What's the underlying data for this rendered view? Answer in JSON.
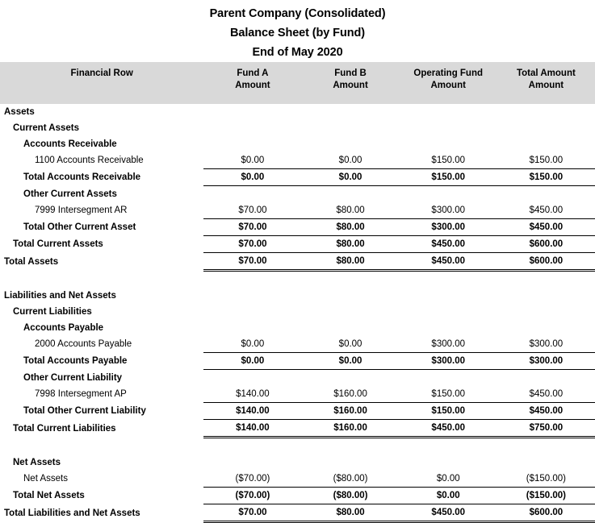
{
  "title": {
    "line1": "Parent Company (Consolidated)",
    "line2": "Balance Sheet (by Fund)",
    "line3": "End of May 2020"
  },
  "header": {
    "label_col": "Financial Row",
    "columns": [
      {
        "name": "Fund A",
        "sub": "Amount"
      },
      {
        "name": "Fund B",
        "sub": "Amount"
      },
      {
        "name": "Operating Fund",
        "sub": "Amount"
      },
      {
        "name": "Total Amount",
        "sub": "Amount"
      }
    ]
  },
  "colors": {
    "header_band": "#D9D9D9",
    "text": "#000000",
    "rule": "#000000",
    "page": "#FFFFFF"
  },
  "rows": [
    {
      "label": "Assets",
      "level": 0,
      "bold": true,
      "values": [
        "",
        "",
        "",
        ""
      ],
      "rule": "none"
    },
    {
      "label": "Current Assets",
      "level": 1,
      "bold": true,
      "values": [
        "",
        "",
        "",
        ""
      ],
      "rule": "none"
    },
    {
      "label": "Accounts Receivable",
      "level": 2,
      "bold": true,
      "values": [
        "",
        "",
        "",
        ""
      ],
      "rule": "none"
    },
    {
      "label": "1100 Accounts Receivable",
      "level": 3,
      "bold": false,
      "values": [
        "$0.00",
        "$0.00",
        "$150.00",
        "$150.00"
      ],
      "rule": "single"
    },
    {
      "label": "Total Accounts Receivable",
      "level": 2,
      "bold": true,
      "values": [
        "$0.00",
        "$0.00",
        "$150.00",
        "$150.00"
      ],
      "rule": "single"
    },
    {
      "label": "Other Current Assets",
      "level": 2,
      "bold": true,
      "values": [
        "",
        "",
        "",
        ""
      ],
      "rule": "none"
    },
    {
      "label": "7999 Intersegment AR",
      "level": 3,
      "bold": false,
      "values": [
        "$70.00",
        "$80.00",
        "$300.00",
        "$450.00"
      ],
      "rule": "single"
    },
    {
      "label": "Total Other Current Asset",
      "level": 2,
      "bold": true,
      "values": [
        "$70.00",
        "$80.00",
        "$300.00",
        "$450.00"
      ],
      "rule": "single"
    },
    {
      "label": "Total Current Assets",
      "level": 1,
      "bold": true,
      "values": [
        "$70.00",
        "$80.00",
        "$450.00",
        "$600.00"
      ],
      "rule": "single"
    },
    {
      "label": "Total Assets",
      "level": 0,
      "bold": true,
      "values": [
        "$70.00",
        "$80.00",
        "$450.00",
        "$600.00"
      ],
      "rule": "double"
    },
    {
      "label": "",
      "level": 0,
      "bold": false,
      "values": [
        "",
        "",
        "",
        ""
      ],
      "rule": "none",
      "spacer": true
    },
    {
      "label": "Liabilities and Net Assets",
      "level": 0,
      "bold": true,
      "values": [
        "",
        "",
        "",
        ""
      ],
      "rule": "none"
    },
    {
      "label": "Current Liabilities",
      "level": 1,
      "bold": true,
      "values": [
        "",
        "",
        "",
        ""
      ],
      "rule": "none"
    },
    {
      "label": "Accounts Payable",
      "level": 2,
      "bold": true,
      "values": [
        "",
        "",
        "",
        ""
      ],
      "rule": "none"
    },
    {
      "label": "2000 Accounts Payable",
      "level": 3,
      "bold": false,
      "values": [
        "$0.00",
        "$0.00",
        "$300.00",
        "$300.00"
      ],
      "rule": "single"
    },
    {
      "label": "Total Accounts Payable",
      "level": 2,
      "bold": true,
      "values": [
        "$0.00",
        "$0.00",
        "$300.00",
        "$300.00"
      ],
      "rule": "single"
    },
    {
      "label": "Other Current Liability",
      "level": 2,
      "bold": true,
      "values": [
        "",
        "",
        "",
        ""
      ],
      "rule": "none"
    },
    {
      "label": "7998 Intersegment AP",
      "level": 3,
      "bold": false,
      "values": [
        "$140.00",
        "$160.00",
        "$150.00",
        "$450.00"
      ],
      "rule": "single"
    },
    {
      "label": "Total Other Current Liability",
      "level": 2,
      "bold": true,
      "values": [
        "$140.00",
        "$160.00",
        "$150.00",
        "$450.00"
      ],
      "rule": "single"
    },
    {
      "label": "Total Current Liabilities",
      "level": 1,
      "bold": true,
      "values": [
        "$140.00",
        "$160.00",
        "$450.00",
        "$750.00"
      ],
      "rule": "double"
    },
    {
      "label": "",
      "level": 0,
      "bold": false,
      "values": [
        "",
        "",
        "",
        ""
      ],
      "rule": "none",
      "spacer": true
    },
    {
      "label": "Net Assets",
      "level": 1,
      "bold": true,
      "values": [
        "",
        "",
        "",
        ""
      ],
      "rule": "none"
    },
    {
      "label": "Net Assets",
      "level": 2,
      "bold": false,
      "values": [
        "($70.00)",
        "($80.00)",
        "$0.00",
        "($150.00)"
      ],
      "rule": "single"
    },
    {
      "label": "Total Net Assets",
      "level": 1,
      "bold": true,
      "values": [
        "($70.00)",
        "($80.00)",
        "$0.00",
        "($150.00)"
      ],
      "rule": "single"
    },
    {
      "label": "Total Liabilities and Net Assets",
      "level": 0,
      "bold": true,
      "values": [
        "$70.00",
        "$80.00",
        "$450.00",
        "$600.00"
      ],
      "rule": "double"
    }
  ]
}
